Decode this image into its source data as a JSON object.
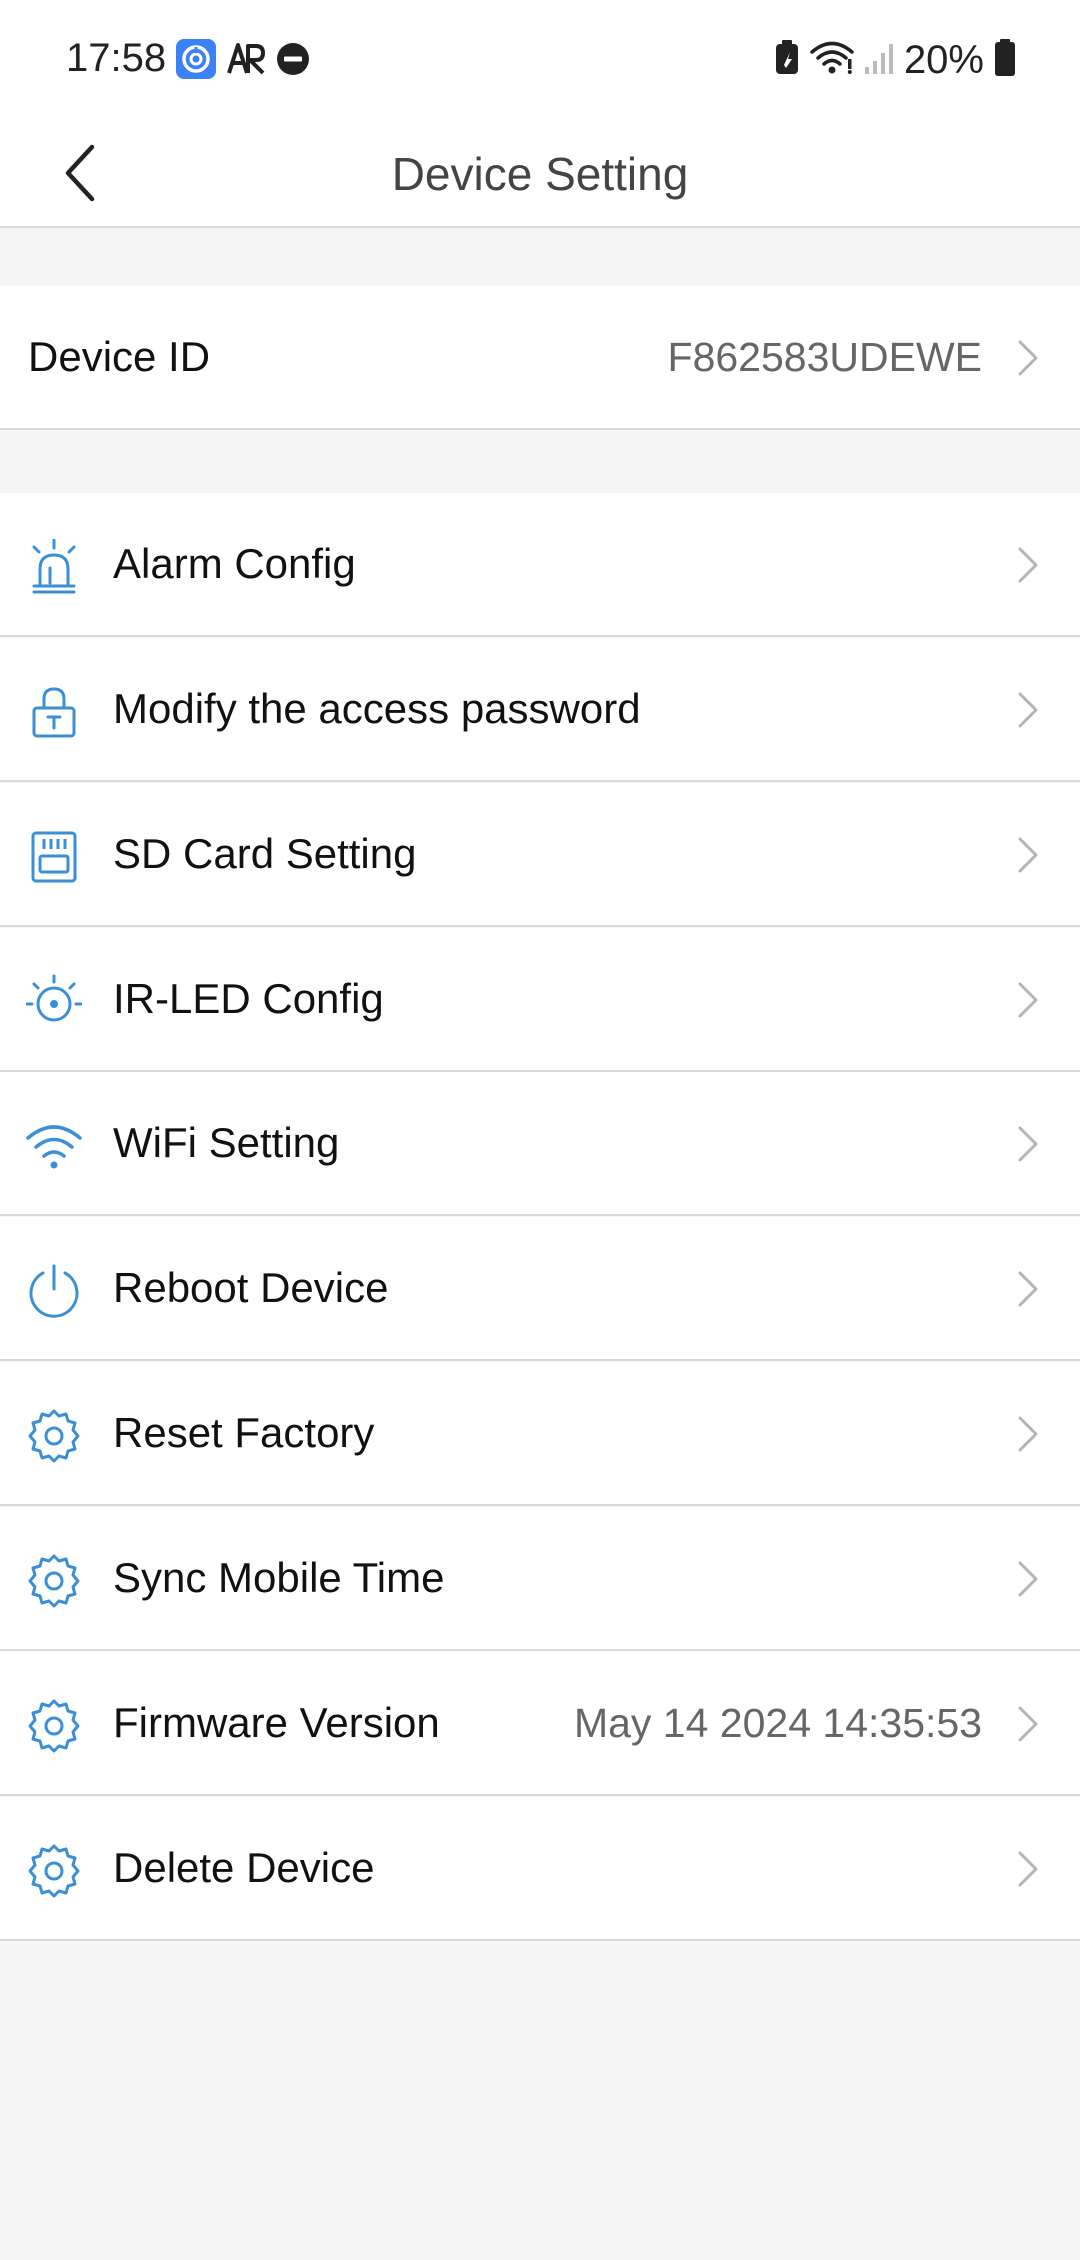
{
  "status_bar": {
    "time": "17:58",
    "battery_percent": "20%",
    "icons": [
      "app-notification-icon",
      "ar-icon",
      "do-not-disturb-icon",
      "battery-saver-icon",
      "wifi-icon",
      "cell-signal-icon",
      "battery-icon"
    ]
  },
  "header": {
    "title": "Device Setting",
    "back_icon": "chevron-left-icon"
  },
  "device_id": {
    "label": "Device ID",
    "value": "F862583UDEWE"
  },
  "menu": {
    "alarm_config": {
      "label": "Alarm Config",
      "icon": "alarm-siren-icon"
    },
    "access_password": {
      "label": "Modify the access password",
      "icon": "lock-icon"
    },
    "sd_card": {
      "label": "SD Card Setting",
      "icon": "sd-card-icon"
    },
    "ir_led": {
      "label": "IR-LED Config",
      "icon": "ir-led-icon"
    },
    "wifi": {
      "label": "WiFi Setting",
      "icon": "wifi-icon"
    },
    "reboot": {
      "label": "Reboot Device",
      "icon": "power-icon"
    },
    "reset_factory": {
      "label": "Reset Factory",
      "icon": "gear-icon"
    },
    "sync_time": {
      "label": "Sync Mobile Time",
      "icon": "gear-icon"
    },
    "firmware": {
      "label": "Firmware Version",
      "value": "May 14 2024 14:35:53",
      "icon": "gear-icon"
    },
    "delete_device": {
      "label": "Delete Device",
      "icon": "gear-icon"
    }
  },
  "colors": {
    "accent_icon": "#3a8fd6",
    "background": "#f5f5f5",
    "row_background": "#ffffff",
    "divider": "#d9d9d9",
    "secondary_text": "#666666"
  }
}
